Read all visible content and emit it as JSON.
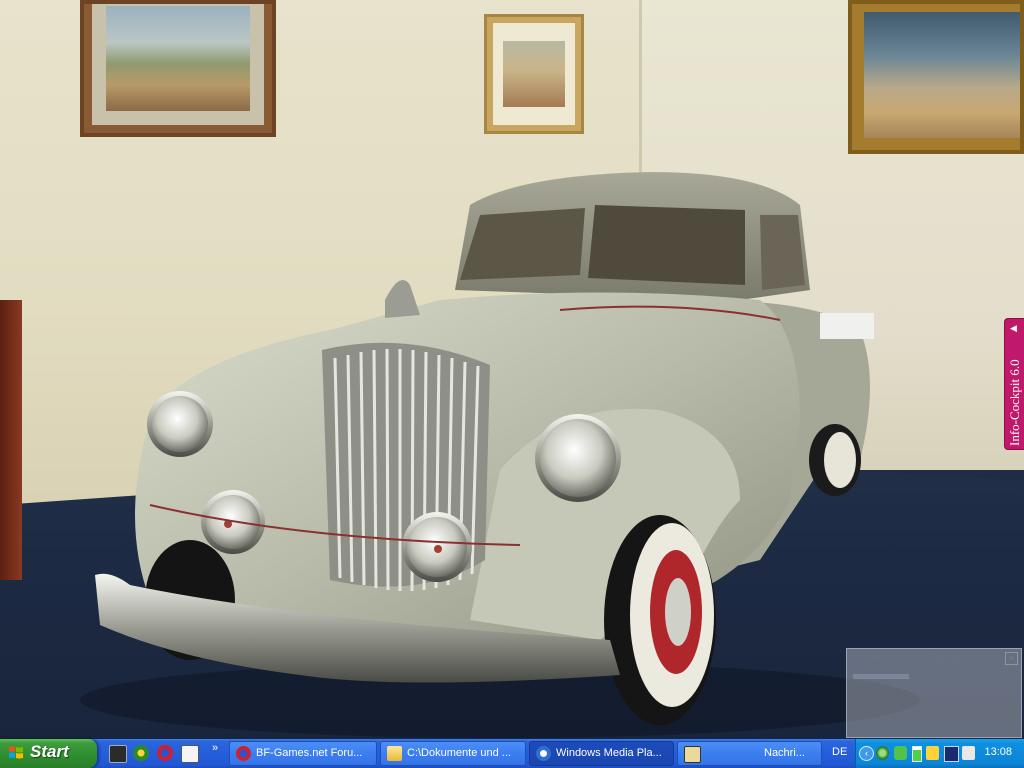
{
  "desktop": {
    "wallpaper": "photo of a silver vintage coupe in a museum room with framed racing paintings"
  },
  "info_cockpit": {
    "label": "Info-Cockpit 6.0",
    "arrow": "◀",
    "color": "#c0186a"
  },
  "notification": {
    "title": "Online-Benachrichtigung",
    "close_glyph": "×"
  },
  "taskbar": {
    "start_label": "Start",
    "quicklaunch_icons": [
      "winamp-icon",
      "settings-icon",
      "opera-icon",
      "email-icon"
    ],
    "chevron": "»",
    "windows": [
      {
        "label": "BF-Games.net Foru...",
        "icon": "opera-icon",
        "active": false
      },
      {
        "label": "C:\\Dokumente und ...",
        "icon": "folder-icon",
        "active": false
      },
      {
        "label": "Windows Media Pla...",
        "icon": "media-player-icon",
        "active": true
      },
      {
        "label": "Nachri...",
        "icon": "messenger-icon",
        "active": false
      }
    ],
    "language": "DE",
    "tray_expand": "‹",
    "tray_icons": [
      "network-icon",
      "recycle-icon",
      "battery-icon",
      "connection-icon",
      "monitor-icon",
      "volume-icon",
      "speedtest-icon"
    ],
    "clock": "13:08"
  }
}
